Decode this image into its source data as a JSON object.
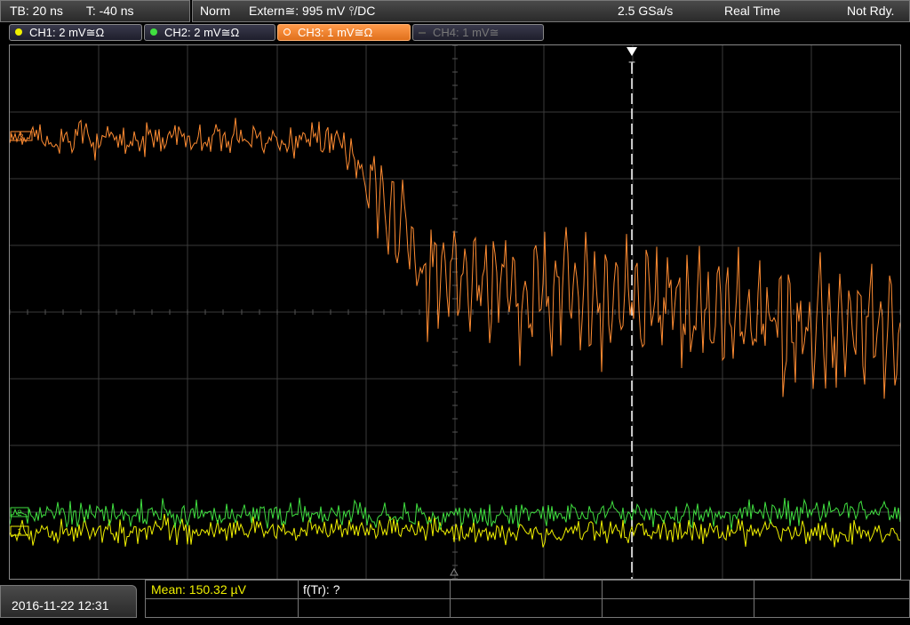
{
  "top": {
    "timebase": "TB: 20 ns",
    "trigger_time": "T: -40 ns",
    "mode": "Norm",
    "trigger_source": "Extern≅: 995 mV ⫯/DC",
    "sample_rate": "2.5 GSa/s",
    "acq_mode": "Real Time",
    "status": "Not Rdy."
  },
  "channels": [
    {
      "label": "CH1: 2 mV≅Ω",
      "color": "#f0f000",
      "active": true
    },
    {
      "label": "CH2: 2 mV≅Ω",
      "color": "#40e040",
      "active": true
    },
    {
      "label": "CH3: 1 mV≅Ω",
      "color": "#ff8c32",
      "active": true,
      "selected": true
    },
    {
      "label": "CH4: 1 mV≅",
      "color": "#666666",
      "active": false
    }
  ],
  "markers": {
    "trigger": "T",
    "ch3": "3",
    "ch2": "2",
    "ch1": "1"
  },
  "bottom": {
    "datetime": "2016-11-22 12:31",
    "mean": "Mean: 150.32 µV",
    "ftr": "f(Tr): ?"
  }
}
